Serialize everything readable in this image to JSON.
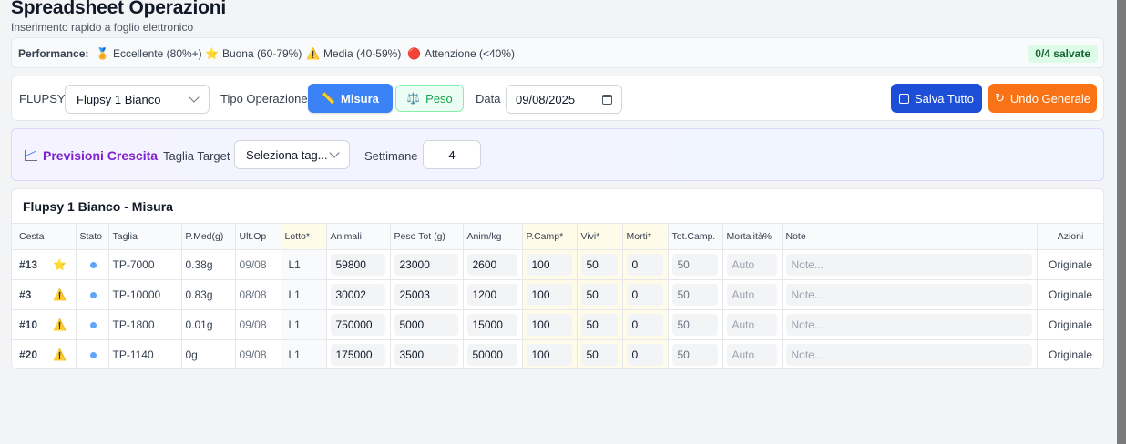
{
  "header": {
    "title": "Spreadsheet Operazioni",
    "subtitle": "Inserimento rapido a foglio elettronico"
  },
  "performance": {
    "label": "Performance:",
    "legend": [
      {
        "icon": "medal-icon",
        "glyph": "🏅",
        "text": "Eccellente (80%+)"
      },
      {
        "icon": "star-icon",
        "glyph": "⭐",
        "text": "Buona (60-79%)"
      },
      {
        "icon": "warning-icon",
        "glyph": "⚠️",
        "text": "Media (40-59%)"
      },
      {
        "icon": "red-dot-icon",
        "glyph": "🔴",
        "text": "Attenzione (<40%)"
      }
    ],
    "saved_badge": "0/4 salvate"
  },
  "controls": {
    "flupsy_label": "FLUPSY",
    "flupsy_value": "Flupsy 1 Bianco",
    "tipo_label": "Tipo Operazione",
    "misura_label": "Misura",
    "peso_label": "Peso",
    "data_label": "Data",
    "data_value": "09/08/2025",
    "save_all_label": "Salva Tutto",
    "undo_label": "Undo Generale"
  },
  "previsioni": {
    "title": "Previsioni Crescita",
    "taglia_label": "Taglia Target",
    "taglia_value": "Seleziona tag...",
    "settimane_label": "Settimane",
    "settimane_value": "4"
  },
  "table": {
    "title": "Flupsy 1 Bianco - Misura",
    "columns": [
      "Cesta",
      "Stato",
      "Taglia",
      "P.Med(g)",
      "Ult.Op",
      "Lotto*",
      "Animali",
      "Peso Tot (g)",
      "Anim/kg",
      "P.Camp*",
      "Vivi*",
      "Morti*",
      "Tot.Camp.",
      "Mortalità%",
      "Note",
      "Azioni"
    ],
    "rows": [
      {
        "cesta": "#13",
        "perf_icon": "star-icon",
        "taglia": "TP-7000",
        "pmed": "0.38g",
        "ultop": "09/08",
        "lotto": "L1",
        "animali": "59800",
        "peso_tot": "23000",
        "anim_kg": "2600",
        "pcamp": "100",
        "vivi": "50",
        "morti": "0",
        "tot_camp": "50",
        "mortalita": "Auto",
        "note": "Note...",
        "azioni": "Originale"
      },
      {
        "cesta": "#3",
        "perf_icon": "warning-icon",
        "taglia": "TP-10000",
        "pmed": "0.83g",
        "ultop": "08/08",
        "lotto": "L1",
        "animali": "30002",
        "peso_tot": "25003",
        "anim_kg": "1200",
        "pcamp": "100",
        "vivi": "50",
        "morti": "0",
        "tot_camp": "50",
        "mortalita": "Auto",
        "note": "Note...",
        "azioni": "Originale"
      },
      {
        "cesta": "#10",
        "perf_icon": "warning-icon",
        "taglia": "TP-1800",
        "pmed": "0.01g",
        "ultop": "09/08",
        "lotto": "L1",
        "animali": "750000",
        "peso_tot": "5000",
        "anim_kg": "15000",
        "pcamp": "100",
        "vivi": "50",
        "morti": "0",
        "tot_camp": "50",
        "mortalita": "Auto",
        "note": "Note...",
        "azioni": "Originale"
      },
      {
        "cesta": "#20",
        "perf_icon": "warning-icon",
        "taglia": "TP-1140",
        "pmed": "0g",
        "ultop": "09/08",
        "lotto": "L1",
        "animali": "175000",
        "peso_tot": "3500",
        "anim_kg": "50000",
        "pcamp": "100",
        "vivi": "50",
        "morti": "0",
        "tot_camp": "50",
        "mortalita": "Auto",
        "note": "Note...",
        "azioni": "Originale"
      }
    ]
  },
  "colors": {
    "primary": "#3b82f6",
    "save": "#1d4ed8",
    "undo": "#f97316",
    "accent_purple": "#7e22ce",
    "success": "#16a34a"
  }
}
